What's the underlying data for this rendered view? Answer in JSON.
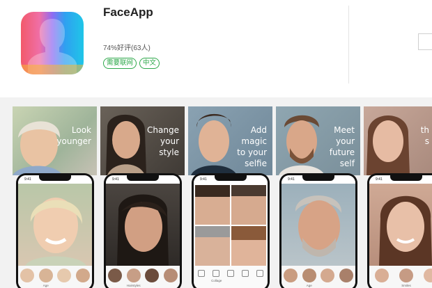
{
  "app": {
    "title": "FaceApp",
    "rating_text": "74%好评(63人)",
    "tags": [
      "需要联网",
      "中文"
    ],
    "icon": "faceapp-logo-icon"
  },
  "screenshots": [
    {
      "caption": [
        "Look",
        "younger"
      ],
      "time": "9:41",
      "tone": "light",
      "thumbs": [
        "",
        "Age",
        "",
        ""
      ]
    },
    {
      "caption": [
        "Change",
        "your",
        "style"
      ],
      "time": "9:41",
      "tone": "dark",
      "thumbs": [
        "",
        "Hairstyles",
        "",
        ""
      ]
    },
    {
      "caption": [
        "Add",
        "magic",
        "to your",
        "selfie"
      ],
      "time": "9:41",
      "tone": "grid",
      "tools": [
        "",
        "Collage",
        "",
        "",
        ""
      ]
    },
    {
      "caption": [
        "Meet",
        "your",
        "future",
        "self"
      ],
      "time": "9:41",
      "tone": "light",
      "thumbs": [
        "",
        "Age",
        "",
        ""
      ]
    },
    {
      "caption": [
        "",
        "th",
        "s"
      ],
      "time": "9:41",
      "tone": "light",
      "thumbs": [
        "",
        "Smiles",
        ""
      ]
    }
  ],
  "colors": {
    "tag_green": "#2da84a",
    "strip_bg": "#f2f2f2"
  }
}
